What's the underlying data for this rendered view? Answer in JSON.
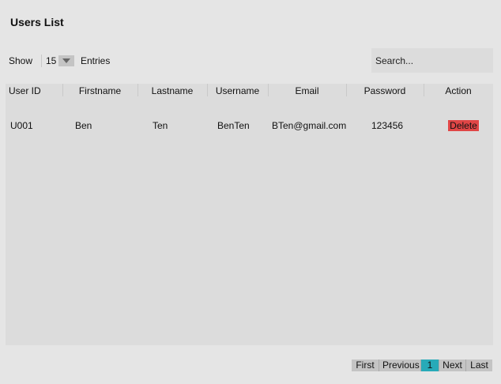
{
  "page": {
    "title": "Users List"
  },
  "entries": {
    "show_label": "Show",
    "value": "15",
    "suffix_label": "Entries"
  },
  "search": {
    "placeholder": "Search..."
  },
  "table": {
    "headers": [
      "User ID",
      "Firstname",
      "Lastname",
      "Username",
      "Email",
      "Password",
      "Action"
    ],
    "rows": [
      {
        "user_id": "U001",
        "firstname": "Ben",
        "lastname": "Ten",
        "username": "BenTen",
        "email": "BTen@gmail.com",
        "password": "123456",
        "action": "Delete"
      }
    ]
  },
  "pagination": {
    "first": "First",
    "previous": "Previous",
    "current": "1",
    "next": "Next",
    "last": "Last"
  },
  "colors": {
    "accent": "#27aab8",
    "danger": "#e04646",
    "panel": "#dcdcdc",
    "background": "#e5e5e5"
  },
  "icons": {
    "entries_dropdown": "caret-down-icon"
  }
}
